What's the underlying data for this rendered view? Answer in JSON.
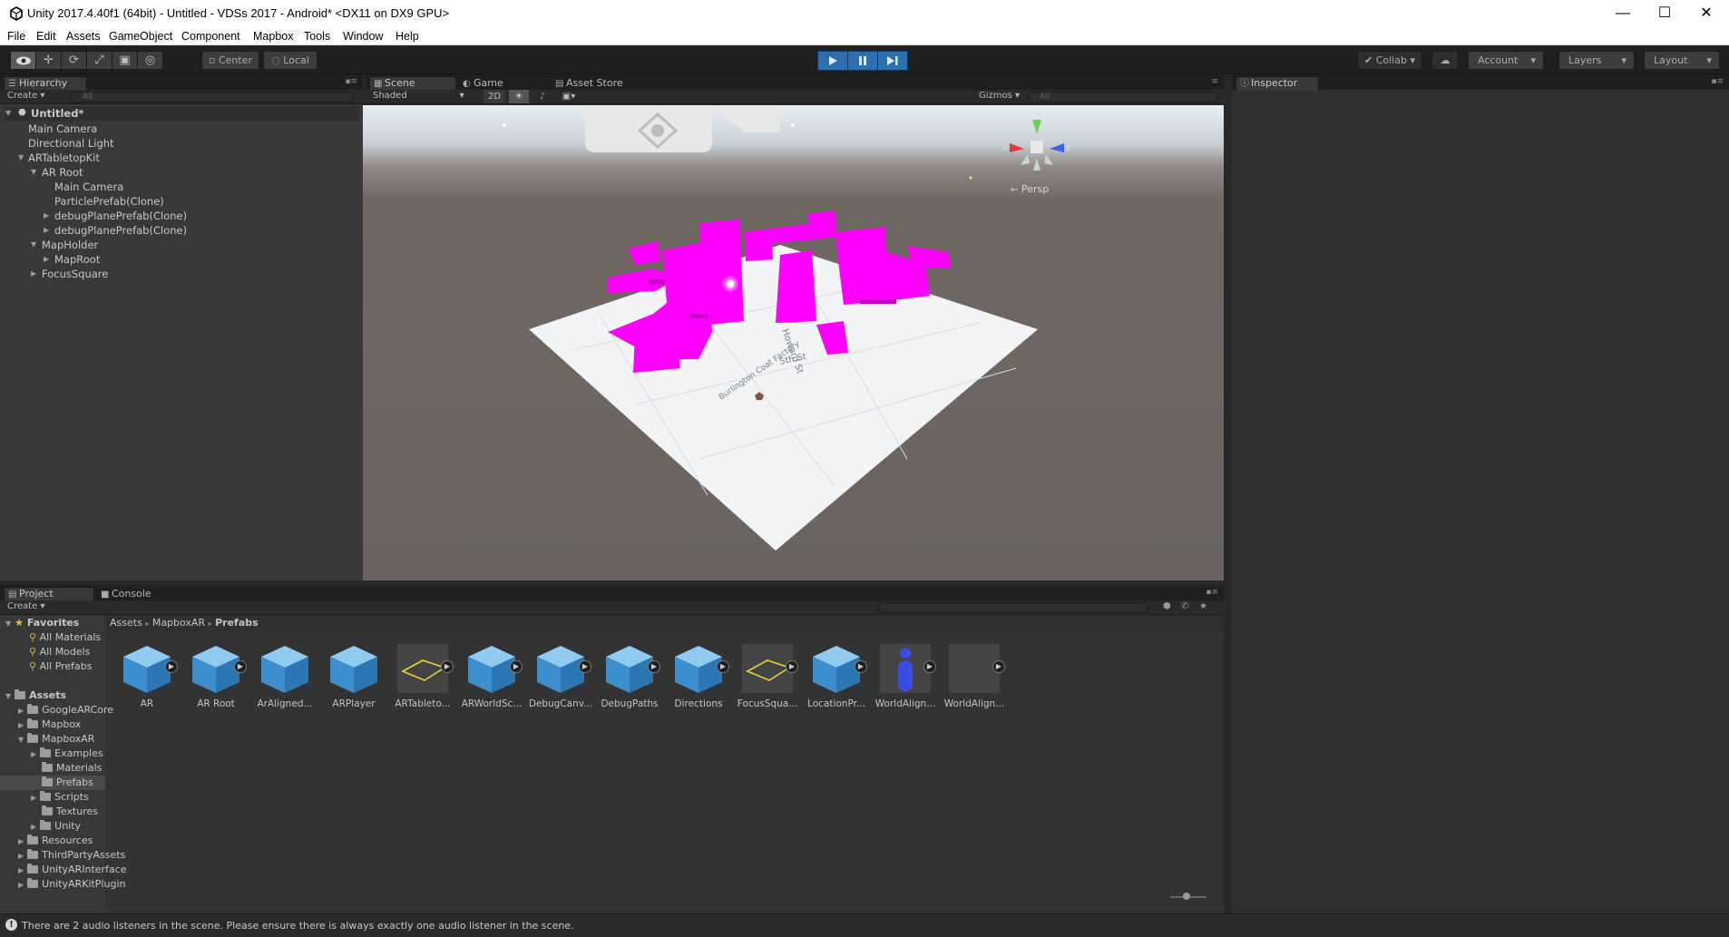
{
  "window": {
    "title": "Unity 2017.4.40f1 (64bit) - Untitled - VDSs 2017 - Android* <DX11 on DX9 GPU>"
  },
  "menu": [
    "File",
    "Edit",
    "Assets",
    "GameObject",
    "Component",
    "Mapbox",
    "Tools",
    "Window",
    "Help"
  ],
  "toolbar": {
    "pivot": "Center",
    "space": "Local",
    "collab": "Collab",
    "account": "Account",
    "layers": "Layers",
    "layout": "Layout"
  },
  "hierarchy": {
    "tab": "Hierarchy",
    "create": "Create",
    "search_placeholder": "All",
    "scene": "Untitled*",
    "items": [
      {
        "label": "Main Camera"
      },
      {
        "label": "Directional Light"
      },
      {
        "label": "ARTabletopKit"
      },
      {
        "label": "AR Root"
      },
      {
        "label": "Main Camera"
      },
      {
        "label": "ParticlePrefab(Clone)"
      },
      {
        "label": "debugPlanePrefab(Clone)"
      },
      {
        "label": "debugPlanePrefab(Clone)"
      },
      {
        "label": "MapHolder"
      },
      {
        "label": "MapRoot"
      },
      {
        "label": "FocusSquare"
      }
    ]
  },
  "scene": {
    "tabs": [
      "Scene",
      "Game",
      "Asset Store"
    ],
    "shading": "Shaded",
    "mode2d": "2D",
    "gizmos": "Gizmos",
    "search_placeholder": "All",
    "persp": "Persp",
    "gizmo_axes": {
      "x": "x",
      "y": "y",
      "z": "z"
    },
    "map_labels": [
      "Howard St",
      "5th St",
      "Burlington Coat Factory"
    ]
  },
  "inspector": {
    "tab": "Inspector"
  },
  "project": {
    "tabs": [
      "Project",
      "Console"
    ],
    "create": "Create",
    "favorites_label": "Favorites",
    "favorites": [
      "All Materials",
      "All Models",
      "All Prefabs"
    ],
    "assets_label": "Assets",
    "tree": [
      "GoogleARCore",
      "Mapbox",
      "MapboxAR",
      "Examples",
      "Materials",
      "Prefabs",
      "Scripts",
      "Textures",
      "Unity",
      "Resources",
      "ThirdPartyAssets",
      "UnityARInterface",
      "UnityARKitPlugin"
    ],
    "breadcrumb": [
      "Assets",
      "MapboxAR",
      "Prefabs"
    ],
    "assets": [
      {
        "label": "AR",
        "icon": "cube-icon"
      },
      {
        "label": "AR Root",
        "icon": "cube-icon"
      },
      {
        "label": "ArAligned...",
        "icon": "cube-icon"
      },
      {
        "label": "ARPlayer",
        "icon": "cube-icon"
      },
      {
        "label": "ARTableto...",
        "icon": "plane-icon"
      },
      {
        "label": "ARWorldSc...",
        "icon": "cube-icon"
      },
      {
        "label": "DebugCanv...",
        "icon": "cube-icon"
      },
      {
        "label": "DebugPaths",
        "icon": "cube-icon"
      },
      {
        "label": "Directions",
        "icon": "cube-icon"
      },
      {
        "label": "FocusSqua...",
        "icon": "plane-icon"
      },
      {
        "label": "LocationPr...",
        "icon": "cube-icon"
      },
      {
        "label": "WorldAlign...",
        "icon": "capsule-icon"
      },
      {
        "label": "WorldAlign...",
        "icon": "empty-icon"
      }
    ]
  },
  "status": {
    "message": "There are 2 audio listeners in the scene. Please ensure there is always exactly one audio listener in the scene."
  },
  "colors": {
    "accent": "#2b6fb0",
    "building": "#ff00ff",
    "panel": "#383838"
  }
}
